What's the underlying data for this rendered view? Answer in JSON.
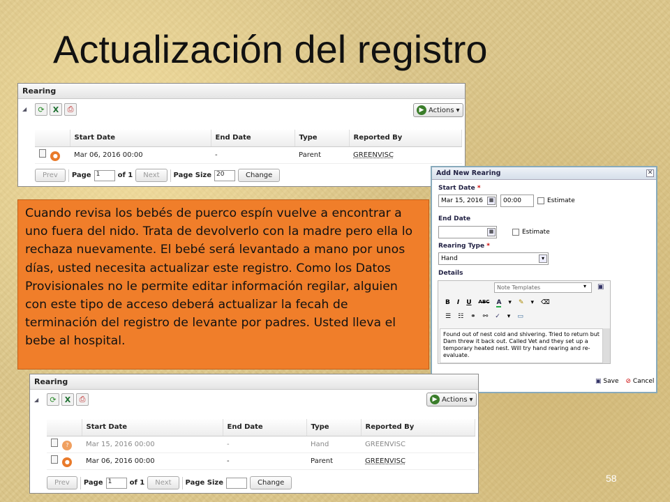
{
  "slide": {
    "title": "Actualización del registro",
    "page_number": "58"
  },
  "panel_before": {
    "header": "Rearing",
    "actions_label": "Actions",
    "columns": [
      "Start Date",
      "End Date",
      "Type",
      "Reported By"
    ],
    "rows": [
      {
        "start": "Mar 06, 2016 00:00",
        "end": "-",
        "type": "Parent",
        "reported_by": "GREENVISC"
      }
    ],
    "pager": {
      "prev": "Prev",
      "page_label": "Page",
      "page_value": "1",
      "of_label": "of 1",
      "next": "Next",
      "size_label": "Page Size",
      "size_value": "20",
      "change": "Change"
    }
  },
  "callout": {
    "text": "Cuando revisa los bebés de puerco espín vuelve a encontrar a uno fuera del nido. Trata de devolverlo con la madre pero ella lo rechaza nuevamente. El bebé será levantado a mano por unos días, usted necesita actualizar este registro. Como los Datos Provisionales no le permite editar información regilar, alguien con este tipo de acceso deberá actualizar la fecah de terminación del registro de levante por padres. Usted lleva el bebe al hospital."
  },
  "dialog": {
    "title": "Add New Rearing",
    "close": "✕",
    "start_date_label": "Start Date",
    "start_date_value": "Mar 15, 2016",
    "start_time_value": "00:00",
    "estimate_label": "Estimate",
    "end_date_label": "End Date",
    "end_estimate_label": "Estimate",
    "rearing_type_label": "Rearing Type",
    "rearing_type_value": "Hand",
    "details_label": "Details",
    "note_templates": "Note Templates",
    "details_text": "Found out of nest cold and shivering. Tried to return but Dam threw it back out. Called Vet and they set up a temporary heated nest. Will try hand rearing and re-evaluate.",
    "save": "Save",
    "cancel": "Cancel",
    "required_mark": "*",
    "editor_tools": {
      "bold": "B",
      "italic": "I",
      "underline": "U",
      "strike": "ABC",
      "font_color": "A"
    }
  },
  "panel_after": {
    "header": "Rearing",
    "actions_label": "Actions",
    "columns": [
      "Start Date",
      "End Date",
      "Type",
      "Reported By"
    ],
    "rows": [
      {
        "start": "Mar 15, 2016 00:00",
        "end": "-",
        "type": "Hand",
        "reported_by": "GREENVISC"
      },
      {
        "start": "Mar 06, 2016 00:00",
        "end": "-",
        "type": "Parent",
        "reported_by": "GREENVISC"
      }
    ],
    "pager": {
      "prev": "Prev",
      "page_label": "Page",
      "page_value": "1",
      "of_label": "of 1",
      "next": "Next",
      "size_label": "Page Size",
      "size_value": "",
      "change": "Change"
    }
  },
  "colors": {
    "callout_bg": "#f07e2a",
    "accent_green": "#3a7d2a",
    "status_orange": "#e97a2a"
  }
}
